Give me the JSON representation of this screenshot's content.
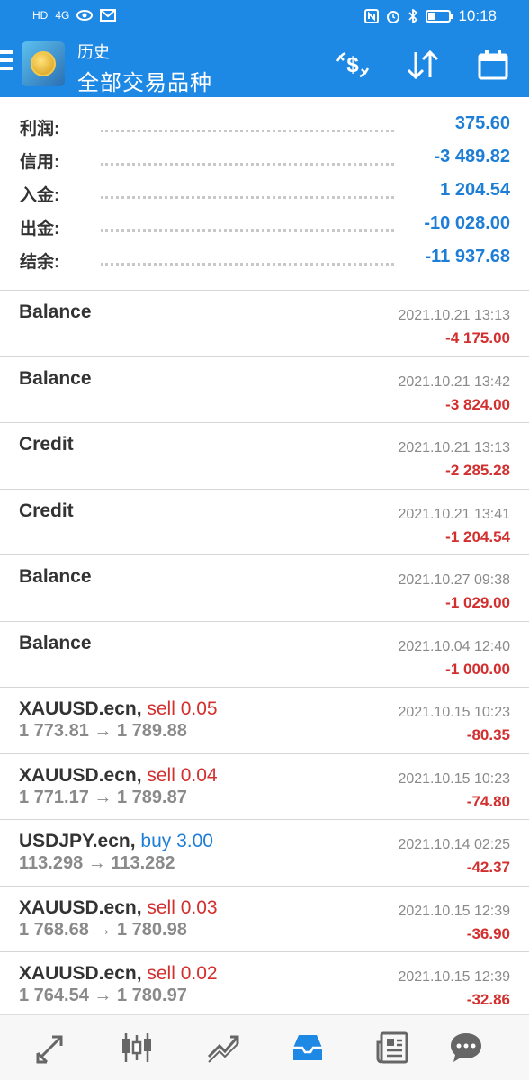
{
  "status_bar": {
    "time": "10:18",
    "left_icons": [
      "HD",
      "4G"
    ]
  },
  "app_bar": {
    "title": "历史",
    "subtitle": "全部交易品种"
  },
  "summary": [
    {
      "label": "利润:",
      "value": "375.60"
    },
    {
      "label": "信用:",
      "value": "-3 489.82"
    },
    {
      "label": "入金:",
      "value": "1 204.54"
    },
    {
      "label": "出金:",
      "value": "-10 028.00"
    },
    {
      "label": "结余:",
      "value": "-11 937.68"
    }
  ],
  "deals": [
    {
      "symbol": "Balance",
      "side": "",
      "prices": "",
      "time": "2021.10.21 13:13",
      "profit": "-4 175.00"
    },
    {
      "symbol": "Balance",
      "side": "",
      "prices": "",
      "time": "2021.10.21 13:42",
      "profit": "-3 824.00"
    },
    {
      "symbol": "Credit",
      "side": "",
      "prices": "",
      "time": "2021.10.21 13:13",
      "profit": "-2 285.28"
    },
    {
      "symbol": "Credit",
      "side": "",
      "prices": "",
      "time": "2021.10.21 13:41",
      "profit": "-1 204.54"
    },
    {
      "symbol": "Balance",
      "side": "",
      "prices": "",
      "time": "2021.10.27 09:38",
      "profit": "-1 029.00"
    },
    {
      "symbol": "Balance",
      "side": "",
      "prices": "",
      "time": "2021.10.04 12:40",
      "profit": "-1 000.00"
    },
    {
      "symbol": "XAUUSD.ecn,",
      "side": "sell 0.05",
      "side_type": "sell",
      "prices": "1 773.81 → 1 789.88",
      "time": "2021.10.15 10:23",
      "profit": "-80.35"
    },
    {
      "symbol": "XAUUSD.ecn,",
      "side": "sell 0.04",
      "side_type": "sell",
      "prices": "1 771.17 → 1 789.87",
      "time": "2021.10.15 10:23",
      "profit": "-74.80"
    },
    {
      "symbol": "USDJPY.ecn,",
      "side": "buy 3.00",
      "side_type": "buy",
      "prices": "113.298 → 113.282",
      "time": "2021.10.14 02:25",
      "profit": "-42.37"
    },
    {
      "symbol": "XAUUSD.ecn,",
      "side": "sell 0.03",
      "side_type": "sell",
      "prices": "1 768.68 → 1 780.98",
      "time": "2021.10.15 12:39",
      "profit": "-36.90"
    },
    {
      "symbol": "XAUUSD.ecn,",
      "side": "sell 0.02",
      "side_type": "sell",
      "prices": "1 764.54 → 1 780.97",
      "time": "2021.10.15 12:39",
      "profit": "-32.86"
    }
  ],
  "bottom_nav": [
    {
      "name": "nav-quotes",
      "icon": "arrows-icon"
    },
    {
      "name": "nav-chart",
      "icon": "candlestick-icon"
    },
    {
      "name": "nav-trade",
      "icon": "trend-icon"
    },
    {
      "name": "nav-history",
      "icon": "inbox-icon",
      "active": true
    },
    {
      "name": "nav-news",
      "icon": "news-icon"
    },
    {
      "name": "nav-chat",
      "icon": "chat-icon"
    }
  ],
  "colors": {
    "primary": "#1e88e5",
    "negative": "#d32f2f",
    "positive": "#1e7ed6",
    "muted": "#8a8a8a"
  }
}
